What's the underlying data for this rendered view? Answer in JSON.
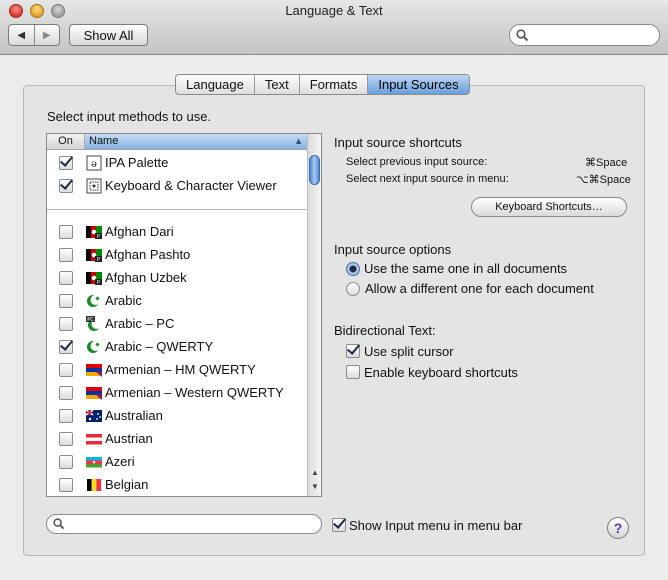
{
  "window": {
    "title": "Language & Text"
  },
  "toolbar": {
    "back_icon": "◀",
    "forward_icon": "▶",
    "show_all_label": "Show All",
    "search_placeholder": ""
  },
  "tabs": [
    {
      "label": "Language",
      "active": false
    },
    {
      "label": "Text",
      "active": false
    },
    {
      "label": "Formats",
      "active": false
    },
    {
      "label": "Input Sources",
      "active": true
    }
  ],
  "instruction": "Select input methods to use.",
  "list": {
    "header_on": "On",
    "header_name": "Name",
    "sort_icon": "▲",
    "special_items": [
      {
        "label": "IPA Palette",
        "checked": true,
        "icon": "ipa-palette-icon"
      },
      {
        "label": "Keyboard & Character Viewer",
        "checked": true,
        "icon": "keyboard-viewer-icon"
      }
    ],
    "items": [
      {
        "label": "Afghan Dari",
        "checked": false,
        "icon": "afghanistan-flag-icon"
      },
      {
        "label": "Afghan Pashto",
        "checked": false,
        "icon": "afghanistan-flag-icon"
      },
      {
        "label": "Afghan Uzbek",
        "checked": false,
        "icon": "afghanistan-flag-icon"
      },
      {
        "label": "Arabic",
        "checked": false,
        "icon": "crescent-icon"
      },
      {
        "label": "Arabic – PC",
        "checked": false,
        "icon": "crescent-pc-icon"
      },
      {
        "label": "Arabic – QWERTY",
        "checked": true,
        "icon": "crescent-icon"
      },
      {
        "label": "Armenian – HM QWERTY",
        "checked": false,
        "icon": "armenia-flag-icon"
      },
      {
        "label": "Armenian – Western QWERTY",
        "checked": false,
        "icon": "armenia-flag-icon"
      },
      {
        "label": "Australian",
        "checked": false,
        "icon": "australia-flag-icon"
      },
      {
        "label": "Austrian",
        "checked": false,
        "icon": "austria-flag-icon"
      },
      {
        "label": "Azeri",
        "checked": false,
        "icon": "azerbaijan-flag-icon"
      },
      {
        "label": "Belgian",
        "checked": false,
        "icon": "belgium-flag-icon"
      }
    ]
  },
  "shortcuts": {
    "title": "Input source shortcuts",
    "prev_label": "Select previous input source:",
    "prev_key": "⌘Space",
    "next_label": "Select next input source in menu:",
    "next_key": "⌥⌘Space",
    "button_label": "Keyboard Shortcuts…"
  },
  "options": {
    "title": "Input source options",
    "radio_same": "Use the same one in all documents",
    "radio_different": "Allow a different one for each document",
    "selected": "same"
  },
  "bidi": {
    "title": "Bidirectional Text:",
    "split_cursor_label": "Use split cursor",
    "split_cursor_checked": true,
    "keyboard_shortcuts_label": "Enable keyboard shortcuts",
    "keyboard_shortcuts_checked": false
  },
  "bottom": {
    "search_placeholder": "",
    "show_menu_label": "Show Input menu in menu bar",
    "show_menu_checked": true,
    "help_label": "?"
  }
}
